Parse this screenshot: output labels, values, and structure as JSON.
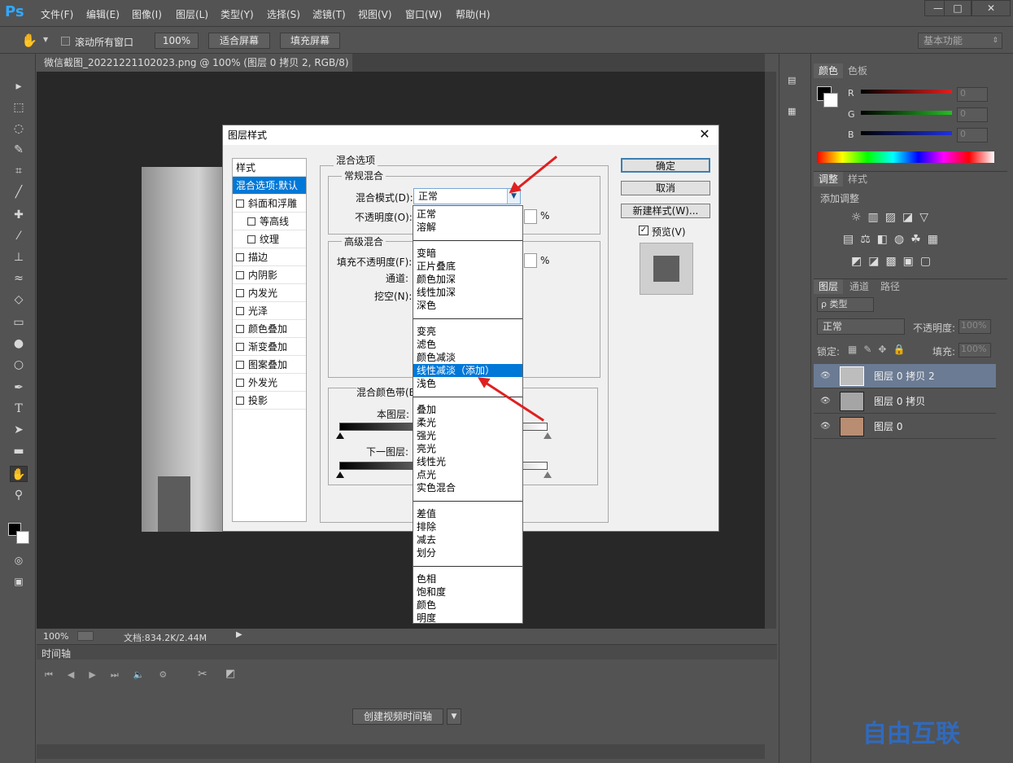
{
  "app": {
    "logo": "Ps",
    "menu": [
      "文件(F)",
      "编辑(E)",
      "图像(I)",
      "图层(L)",
      "类型(Y)",
      "选择(S)",
      "滤镜(T)",
      "视图(V)",
      "窗口(W)",
      "帮助(H)"
    ],
    "window_controls": [
      "—",
      "□",
      "✕"
    ]
  },
  "options_bar": {
    "scroll_all": "滚动所有窗口",
    "zoom_100": "100%",
    "fit_screen": "适合屏幕",
    "fill_screen": "填充屏幕",
    "workspace": "基本功能"
  },
  "document": {
    "tab_title": "微信截图_20221221102023.png @ 100% (图层 0 拷贝 2, RGB/8) *",
    "zoom": "100%",
    "doc_size": "文档:834.2K/2.44M"
  },
  "timeline": {
    "title": "时间轴",
    "create_button": "创建视频时间轴"
  },
  "color_panel": {
    "tabs": [
      "颜色",
      "色板"
    ],
    "channels": [
      {
        "label": "R",
        "value": "0",
        "color": "#e02020"
      },
      {
        "label": "G",
        "value": "0",
        "color": "#20c020"
      },
      {
        "label": "B",
        "value": "0",
        "color": "#2030e0"
      }
    ]
  },
  "adjust_panel": {
    "tabs": [
      "调整",
      "样式"
    ],
    "add_label": "添加调整"
  },
  "layers_panel": {
    "tabs": [
      "图层",
      "通道",
      "路径"
    ],
    "filter": "ρ 类型",
    "blend_mode": "正常",
    "opacity_label": "不透明度:",
    "opacity_value": "100%",
    "lock_label": "锁定:",
    "fill_label": "填充:",
    "fill_value": "100%",
    "layers": [
      {
        "name": "图层 0 拷贝 2",
        "selected": true
      },
      {
        "name": "图层 0 拷贝",
        "selected": false
      },
      {
        "name": "图层 0",
        "selected": false
      }
    ]
  },
  "dialog": {
    "title": "图层样式",
    "close": "✕",
    "styles_header": "样式",
    "style_items": [
      {
        "label": "混合选项:默认",
        "checkbox": false,
        "active": true,
        "indent": false
      },
      {
        "label": "斜面和浮雕",
        "checkbox": true,
        "active": false,
        "indent": false
      },
      {
        "label": "等高线",
        "checkbox": true,
        "active": false,
        "indent": true
      },
      {
        "label": "纹理",
        "checkbox": true,
        "active": false,
        "indent": true
      },
      {
        "label": "描边",
        "checkbox": true,
        "active": false,
        "indent": false
      },
      {
        "label": "内阴影",
        "checkbox": true,
        "active": false,
        "indent": false
      },
      {
        "label": "内发光",
        "checkbox": true,
        "active": false,
        "indent": false
      },
      {
        "label": "光泽",
        "checkbox": true,
        "active": false,
        "indent": false
      },
      {
        "label": "颜色叠加",
        "checkbox": true,
        "active": false,
        "indent": false
      },
      {
        "label": "渐变叠加",
        "checkbox": true,
        "active": false,
        "indent": false
      },
      {
        "label": "图案叠加",
        "checkbox": true,
        "active": false,
        "indent": false
      },
      {
        "label": "外发光",
        "checkbox": true,
        "active": false,
        "indent": false
      },
      {
        "label": "投影",
        "checkbox": true,
        "active": false,
        "indent": false
      }
    ],
    "blend_options": "混合选项",
    "general_blend": "常规混合",
    "blend_mode_label": "混合模式(D):",
    "blend_mode_value": "正常",
    "opacity_label": "不透明度(O):",
    "percent": "%",
    "advanced_blend": "高级混合",
    "fill_opacity_label": "填充不透明度(F):",
    "channels_label": "通道:",
    "knockout_label": "挖空(N):",
    "blend_if_label": "混合颜色带(E",
    "this_layer": "本图层:",
    "underlying_layer": "下一图层:",
    "ok": "确定",
    "cancel": "取消",
    "new_style": "新建样式(W)...",
    "preview": "预览(V)"
  },
  "dropdown": {
    "groups": [
      [
        "正常",
        "溶解"
      ],
      [
        "变暗",
        "正片叠底",
        "颜色加深",
        "线性加深",
        "深色"
      ],
      [
        "变亮",
        "滤色",
        "颜色减淡",
        "线性减淡（添加）",
        "浅色"
      ],
      [
        "叠加",
        "柔光",
        "强光",
        "亮光",
        "线性光",
        "点光",
        "实色混合"
      ],
      [
        "差值",
        "排除",
        "减去",
        "划分"
      ],
      [
        "色相",
        "饱和度",
        "颜色",
        "明度"
      ]
    ],
    "selected": "线性减淡（添加）"
  },
  "watermark": "自由互联",
  "accent_color": "#0078d7",
  "annotation_color": "#e02020"
}
